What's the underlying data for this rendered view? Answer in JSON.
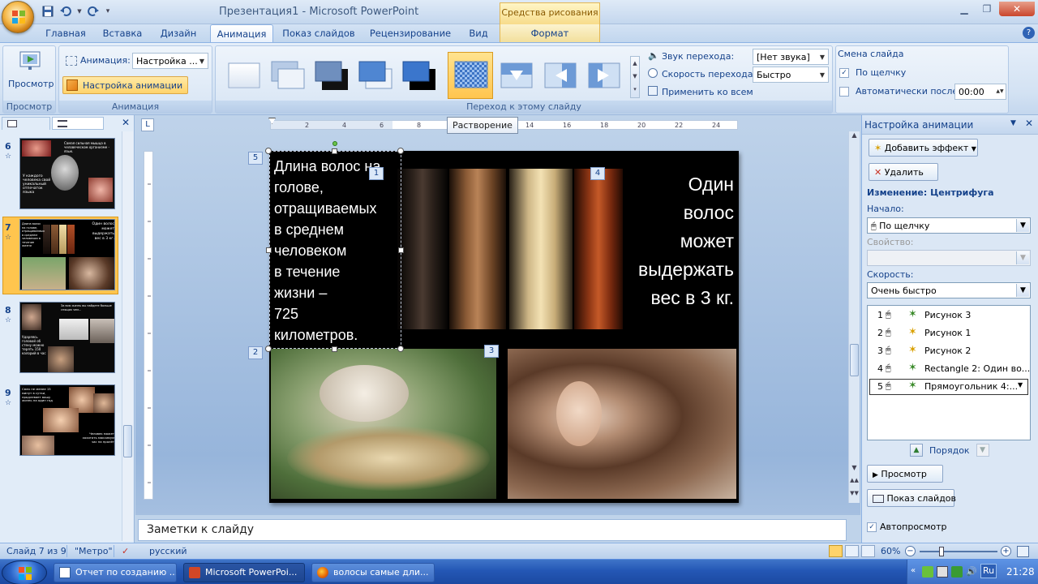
{
  "window": {
    "title": "Презентация1 - Microsoft PowerPoint",
    "context_header": "Средства рисования",
    "controls": [
      "minimize",
      "restore",
      "close"
    ]
  },
  "tabs": [
    {
      "label": "Главная",
      "active": false
    },
    {
      "label": "Вставка",
      "active": false
    },
    {
      "label": "Дизайн",
      "active": false
    },
    {
      "label": "Анимация",
      "active": true
    },
    {
      "label": "Показ слайдов",
      "active": false
    },
    {
      "label": "Рецензирование",
      "active": false
    },
    {
      "label": "Вид",
      "active": false
    },
    {
      "label": "Формат",
      "active": false
    }
  ],
  "ribbon": {
    "preview": {
      "button": "Просмотр",
      "group": "Просмотр"
    },
    "animations": {
      "animation_label": "Анимация:",
      "animation_value": "Настройка ...",
      "custom_button": "Настройка анимации",
      "group": "Анимация"
    },
    "transition": {
      "group": "Переход к этому слайду",
      "sound_label": "Звук перехода:",
      "sound_value": "[Нет звука]",
      "speed_label": "Скорость перехода:",
      "speed_value": "Быстро",
      "apply_all": "Применить ко всем",
      "selected_effect": "Растворение"
    },
    "advance": {
      "group_title": "Смена слайда",
      "on_click_label": "По щелчку",
      "on_click_checked": true,
      "auto_label": "Автоматически после:",
      "auto_checked": false,
      "auto_value": "00:00"
    }
  },
  "thumbnails": {
    "slides": [
      {
        "number": "6",
        "text_a": "У каждого человека свой уникальный отпечаток языка",
        "text_b": "Самая сильная мышца в человеческом организме - язык."
      },
      {
        "number": "7",
        "text_a": "Длина волос на голове, отращиваемых в среднем человеком в течение жизни",
        "text_b": "Один волос может выдержать вес в 3 кг.",
        "selected": true
      },
      {
        "number": "8",
        "text_a": "Ударяясь головой об стену можно терять 150 калорий в час",
        "text_b": "За всю жизнь вы найдете больше спящих чем...",
        "text_c": ""
      },
      {
        "number": "9",
        "text_a": "Смех не менее 15 минут в сутки, продлевает вашу жизнь на один год",
        "text_b": "Человек может хохотать максимум час на пролёт"
      }
    ]
  },
  "slide": {
    "left_text": "Длина волос на голове, отращиваемых в среднем человеком в течение жизни – 725 километров.",
    "left_lines": [
      "Длина волос на",
      "голове,",
      "отращиваемых",
      "в среднем",
      "человеком",
      "в течение",
      "жизни –",
      "725",
      "километров."
    ],
    "right_lines": [
      "Один",
      "волос",
      "может",
      "выдержать",
      "вес в 3 кг."
    ],
    "tags": [
      "5",
      "1",
      "4",
      "2",
      "3"
    ]
  },
  "notes": {
    "placeholder": "Заметки к слайду"
  },
  "taskpane": {
    "title": "Настройка анимации",
    "add_effect": "Добавить эффект",
    "remove": "Удалить",
    "change_label": "Изменение: Центрифуга",
    "start_label": "Начало:",
    "start_value": "По щелчку",
    "property_label": "Свойство:",
    "property_value": "",
    "speed_label": "Скорость:",
    "speed_value": "Очень быстро",
    "items": [
      {
        "index": "1",
        "name": "Рисунок 3"
      },
      {
        "index": "2",
        "name": "Рисунок 1"
      },
      {
        "index": "3",
        "name": "Рисунок 2"
      },
      {
        "index": "4",
        "name": "Rectangle 2: Один во..."
      },
      {
        "index": "5",
        "name": "Прямоугольник 4:..."
      }
    ],
    "order_label": "Порядок",
    "play": "Просмотр",
    "slideshow": "Показ слайдов",
    "autopreview": "Автопросмотр",
    "autopreview_checked": true
  },
  "statusbar": {
    "slide_info": "Слайд 7 из 9",
    "theme": "\"Метро\"",
    "language": "русский",
    "zoom": "60%"
  },
  "taskbar": {
    "items": [
      {
        "label": "Отчет по созданию ...",
        "active": false
      },
      {
        "label": "Microsoft PowerPoi...",
        "active": true
      },
      {
        "label": "волосы самые дли...",
        "active": false
      }
    ],
    "lang": "Ru",
    "clock": "21:28"
  },
  "colors": {
    "accent": "#15428b",
    "ribbon_bg": "#dce8f6",
    "selected_gold": "#ffc54e",
    "taskbar": "#2457b5"
  }
}
